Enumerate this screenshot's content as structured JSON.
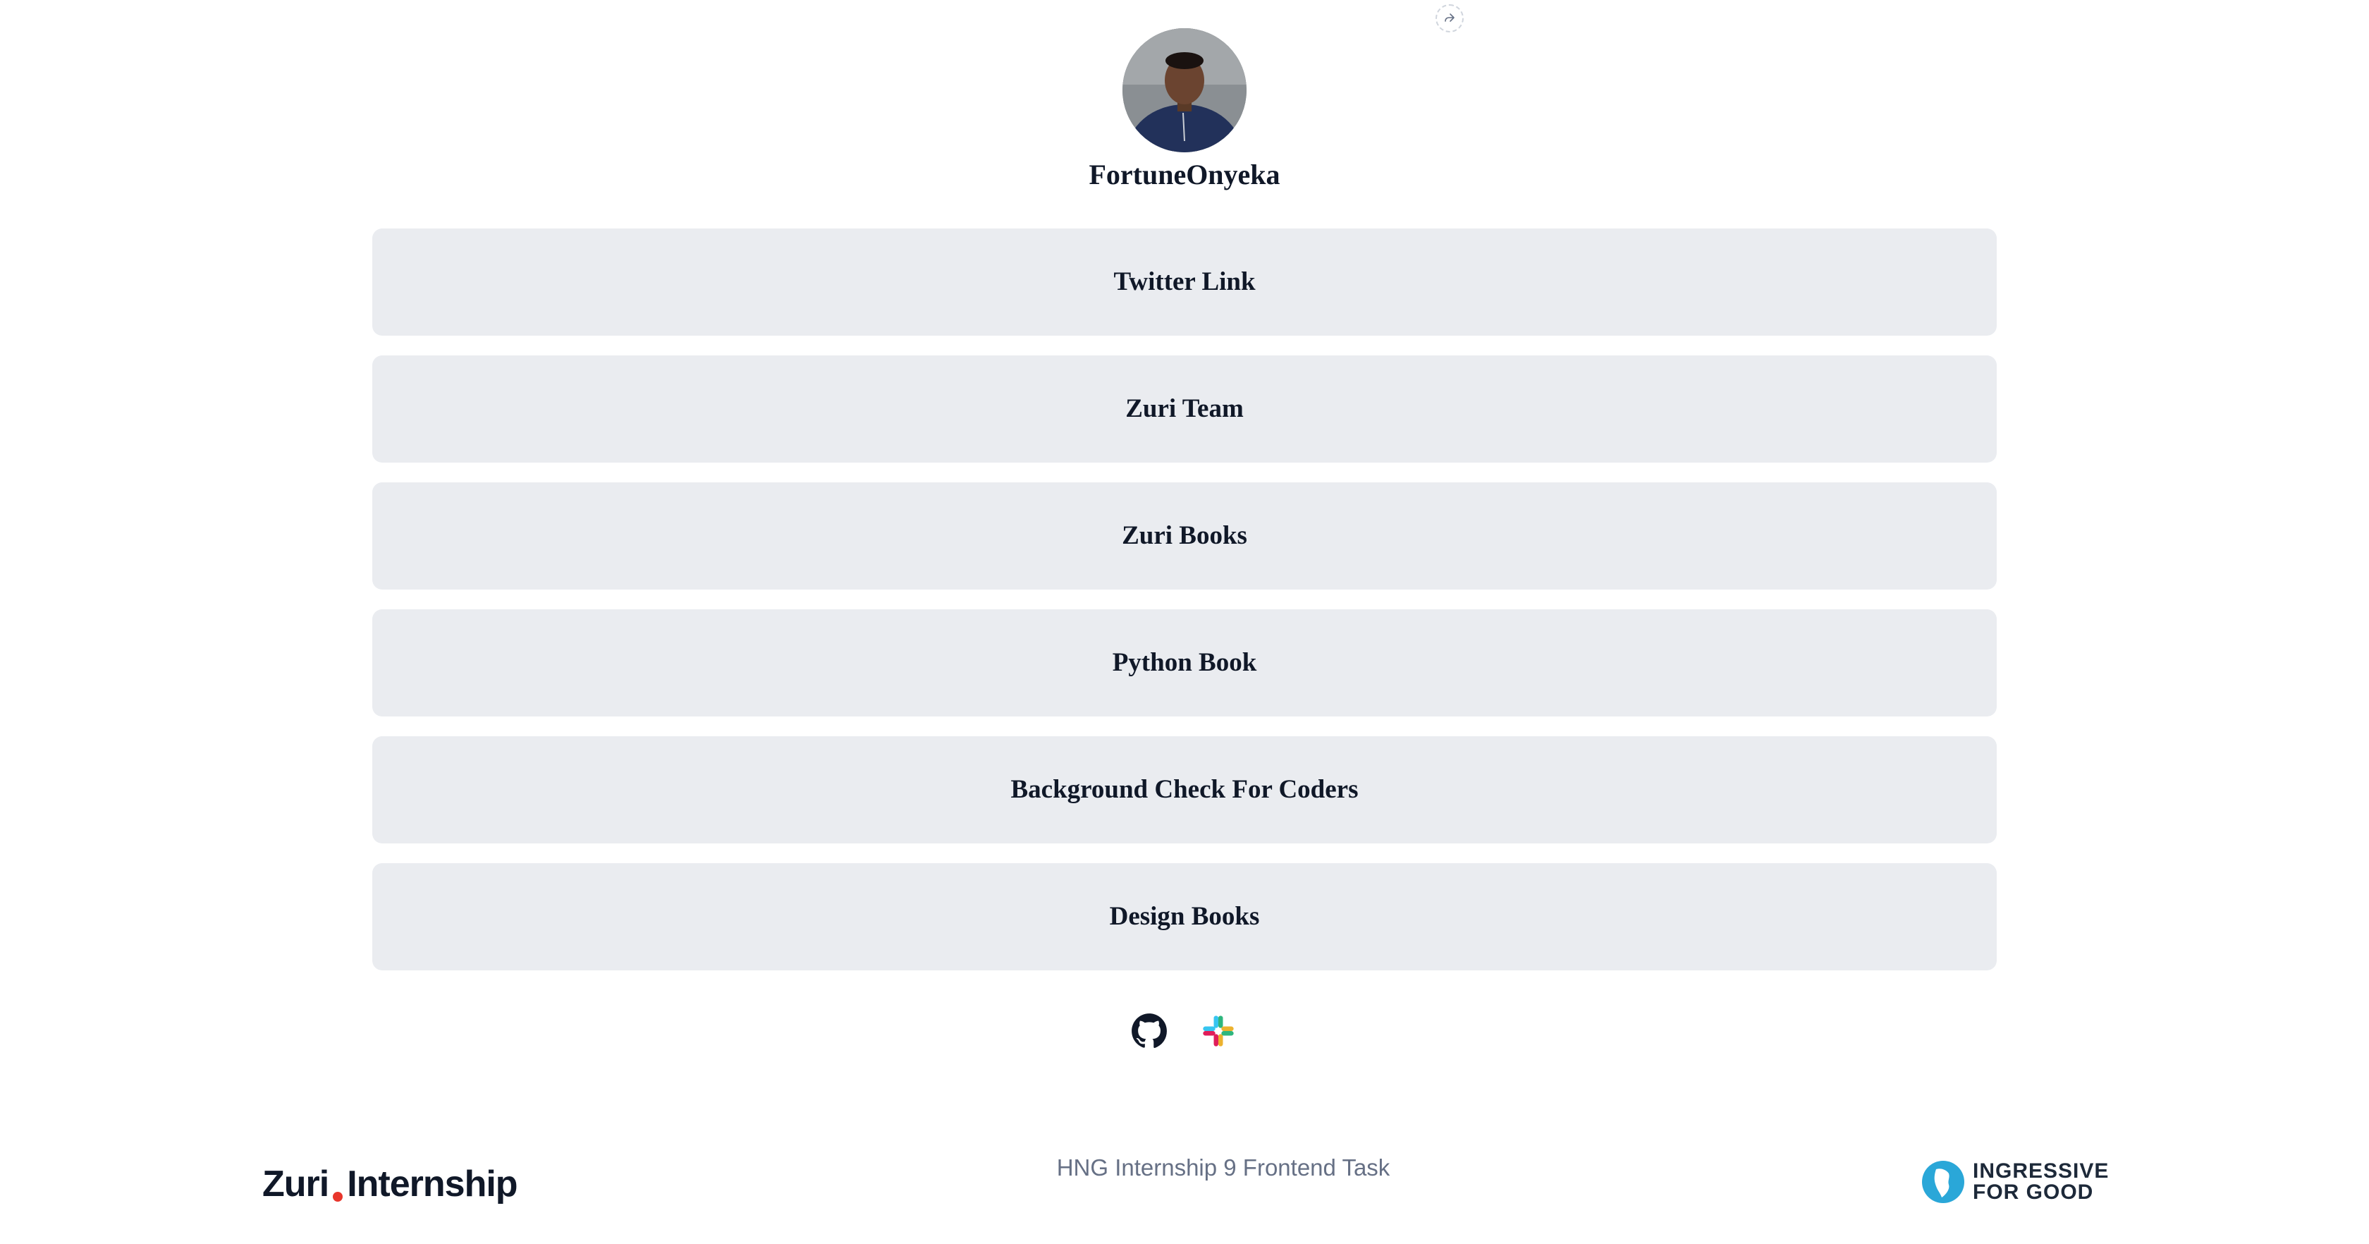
{
  "profile": {
    "name": "FortuneOnyeka"
  },
  "links": [
    {
      "label": "Twitter Link"
    },
    {
      "label": "Zuri Team"
    },
    {
      "label": "Zuri Books"
    },
    {
      "label": "Python Book"
    },
    {
      "label": "Background Check For Coders"
    },
    {
      "label": "Design Books"
    }
  ],
  "socials": [
    {
      "icon": "github-icon"
    },
    {
      "icon": "slack-icon"
    }
  ],
  "footer": {
    "left_logo_part1": "Zuri",
    "left_logo_part2": "Internship",
    "center_text": "HNG Internship 9 Frontend Task",
    "right_logo_line1": "INGRESSIVE",
    "right_logo_line2": "FOR GOOD"
  },
  "colors": {
    "button_bg": "#eaecf0",
    "text_primary": "#101828",
    "text_muted": "#667085",
    "zuri_dot": "#e8362c"
  }
}
